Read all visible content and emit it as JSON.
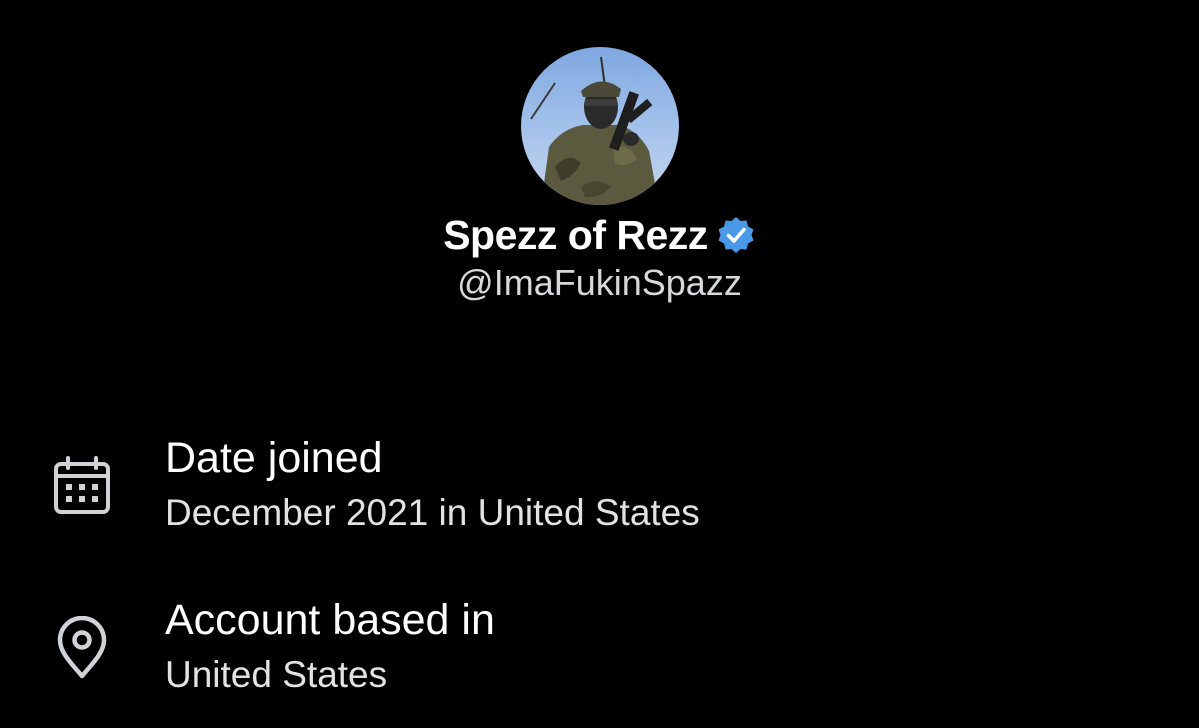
{
  "profile": {
    "display_name": "Spezz of Rezz",
    "handle": "@ImaFukinSpazz",
    "verified_color": "#4a99e9",
    "avatar": "profile-photo"
  },
  "details": [
    {
      "icon": "calendar-icon",
      "label": "Date joined",
      "value": "December 2021 in United States"
    },
    {
      "icon": "location-pin-icon",
      "label": "Account based in",
      "value": "United States"
    }
  ],
  "colors": {
    "background": "#000000",
    "text_primary": "#ffffff",
    "text_secondary": "#d6d9db",
    "icon": "#cfd3d6"
  }
}
